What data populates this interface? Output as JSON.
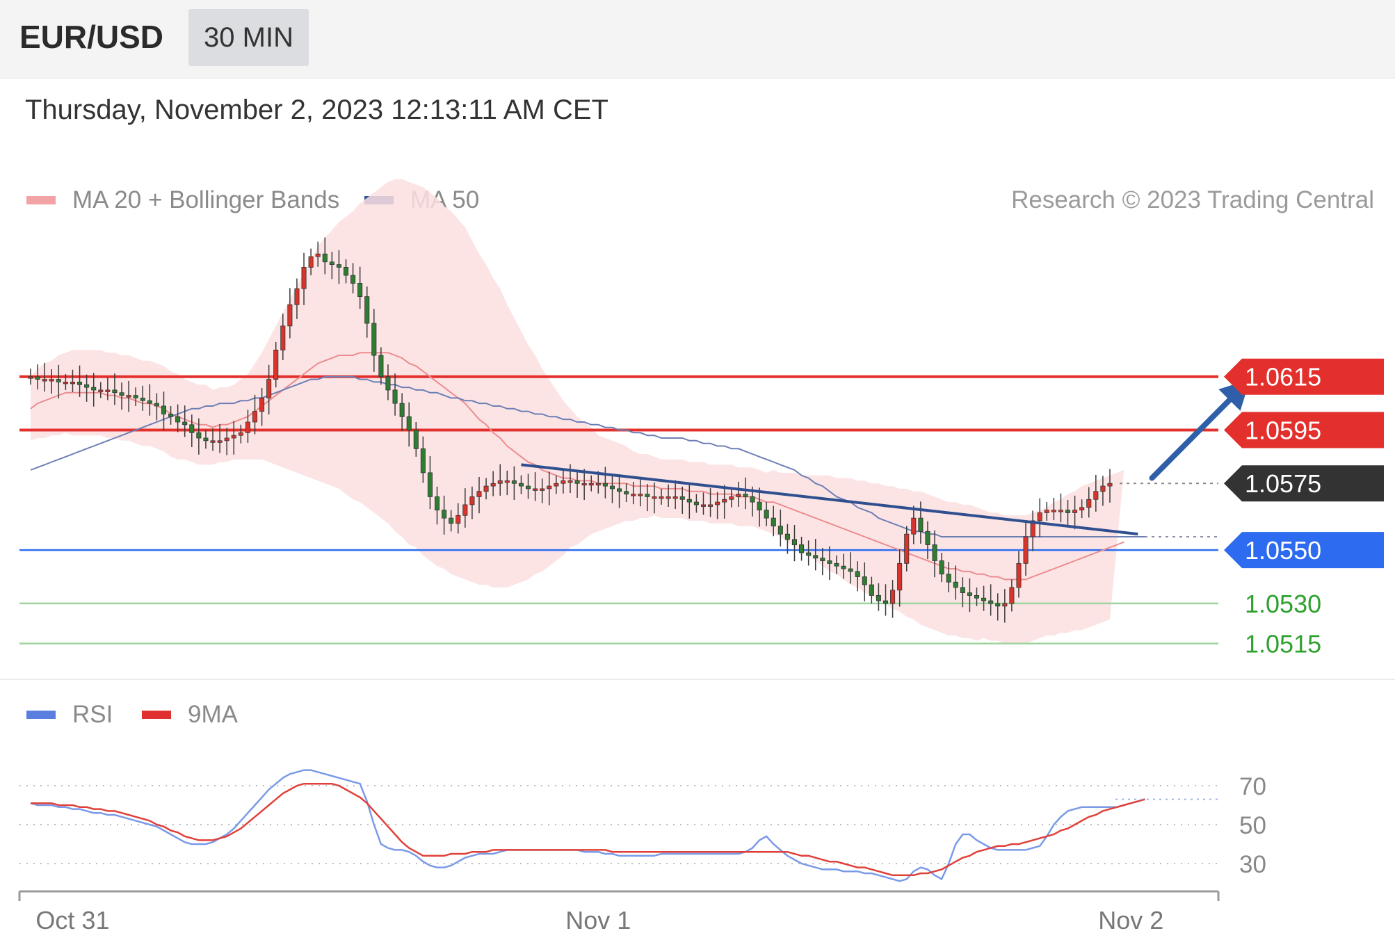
{
  "header": {
    "pair": "EUR/USD",
    "timeframe": "30 MIN"
  },
  "datetime": "Thursday, November 2, 2023 12:13:11 AM CET",
  "legend_main": [
    {
      "label": "MA 20 + Bollinger Bands",
      "color": "#e8868a"
    },
    {
      "label": "MA 50",
      "color": "#2f5597"
    }
  ],
  "legend_rsi": [
    {
      "label": "RSI",
      "color": "#5b7fe0"
    },
    {
      "label": "9MA",
      "color": "#e03030"
    }
  ],
  "copyright": "Research © 2023 Trading Central",
  "colors": {
    "resistance": "#e3302c",
    "current": "#333333",
    "pivot": "#2d6cf0",
    "support": "#2fa12f",
    "up_candle": "#d9342b",
    "down_candle": "#2e7d32",
    "arrow": "#2f5fa8",
    "trendline": "#2f4f8f"
  },
  "chart_data": [
    {
      "type": "candlestick",
      "title": "EUR/USD",
      "timeframe": "30 MIN",
      "x_tick_labels": [
        "Oct 31",
        "Nov 1",
        "Nov 2"
      ],
      "x_tick_index": [
        6,
        81,
        157
      ],
      "ylim": [
        1.0506,
        1.0678
      ],
      "levels": [
        {
          "label": "1.0615",
          "value": 1.0615,
          "kind": "resistance"
        },
        {
          "label": "1.0595",
          "value": 1.0595,
          "kind": "resistance"
        },
        {
          "label": "1.0575",
          "value": 1.0575,
          "kind": "current"
        },
        {
          "label": "1.0550",
          "value": 1.055,
          "kind": "pivot"
        },
        {
          "label": "1.0530",
          "value": 1.053,
          "kind": "support"
        },
        {
          "label": "1.0515",
          "value": 1.0515,
          "kind": "support"
        }
      ],
      "candles_close": [
        1.0615,
        1.0614,
        1.0614,
        1.0614,
        1.0613,
        1.0613,
        1.0613,
        1.0612,
        1.0611,
        1.061,
        1.061,
        1.061,
        1.0609,
        1.0608,
        1.0608,
        1.0607,
        1.0606,
        1.0605,
        1.0604,
        1.0601,
        1.06,
        1.0598,
        1.0597,
        1.0594,
        1.0592,
        1.0591,
        1.0591,
        1.0591,
        1.0592,
        1.0593,
        1.0594,
        1.0598,
        1.0602,
        1.0607,
        1.0614,
        1.0625,
        1.0634,
        1.0642,
        1.0648,
        1.0656,
        1.066,
        1.0661,
        1.0658,
        1.0657,
        1.0656,
        1.0653,
        1.065,
        1.0645,
        1.0635,
        1.0623,
        1.0615,
        1.061,
        1.0605,
        1.06,
        1.0595,
        1.0588,
        1.0579,
        1.057,
        1.0565,
        1.0562,
        1.056,
        1.0563,
        1.0567,
        1.057,
        1.0572,
        1.0574,
        1.0575,
        1.0576,
        1.0576,
        1.0575,
        1.0574,
        1.0573,
        1.0573,
        1.0573,
        1.0574,
        1.0575,
        1.0576,
        1.0576,
        1.0575,
        1.0575,
        1.0575,
        1.0575,
        1.0574,
        1.0573,
        1.0572,
        1.0571,
        1.0571,
        1.0571,
        1.057,
        1.057,
        1.057,
        1.057,
        1.057,
        1.0569,
        1.0568,
        1.0567,
        1.0567,
        1.0567,
        1.0568,
        1.0569,
        1.057,
        1.0571,
        1.057,
        1.0568,
        1.0565,
        1.0562,
        1.0559,
        1.0556,
        1.0554,
        1.0552,
        1.0549,
        1.0548,
        1.0547,
        1.0546,
        1.0545,
        1.0544,
        1.0543,
        1.0542,
        1.054,
        1.0537,
        1.0533,
        1.0531,
        1.053,
        1.0535,
        1.0545,
        1.0556,
        1.0562,
        1.0557,
        1.0552,
        1.0546,
        1.0541,
        1.0538,
        1.0536,
        1.0534,
        1.0533,
        1.0532,
        1.0531,
        1.053,
        1.0529,
        1.053,
        1.0536,
        1.0545,
        1.0555,
        1.0561,
        1.0564,
        1.0565,
        1.0565,
        1.0565,
        1.0564,
        1.0565,
        1.0566,
        1.0569,
        1.0572,
        1.0574,
        1.0575
      ],
      "ma20": [
        1.0603,
        1.0605,
        1.0606,
        1.0607,
        1.0608,
        1.0609,
        1.0609,
        1.0609,
        1.0609,
        1.0609,
        1.0609,
        1.0608,
        1.0608,
        1.0607,
        1.0607,
        1.0606,
        1.0605,
        1.0605,
        1.0604,
        1.0603,
        1.0601,
        1.06,
        1.0599,
        1.0598,
        1.0597,
        1.0597,
        1.0596,
        1.0597,
        1.0597,
        1.0598,
        1.0599,
        1.06,
        1.0602,
        1.0604,
        1.0606,
        1.0608,
        1.061,
        1.0612,
        1.0614,
        1.0616,
        1.0618,
        1.062,
        1.0621,
        1.0622,
        1.0623,
        1.0623,
        1.0623,
        1.0624,
        1.0624,
        1.0624,
        1.0624,
        1.0624,
        1.0623,
        1.0622,
        1.062,
        1.0619,
        1.0617,
        1.0615,
        1.0613,
        1.0611,
        1.0609,
        1.0607,
        1.0605,
        1.0602,
        1.0599,
        1.0597,
        1.0594,
        1.0592,
        1.0589,
        1.0587,
        1.0585,
        1.0583,
        1.0582,
        1.058,
        1.0579,
        1.0578,
        1.0577,
        1.0577,
        1.0576,
        1.0576,
        1.0576,
        1.0575,
        1.0575,
        1.0575,
        1.0575,
        1.0575,
        1.0574,
        1.0574,
        1.0574,
        1.0574,
        1.0573,
        1.0573,
        1.0573,
        1.0573,
        1.0572,
        1.0572,
        1.0572,
        1.0571,
        1.0571,
        1.0571,
        1.0571,
        1.057,
        1.057,
        1.057,
        1.0569,
        1.0568,
        1.0568,
        1.0567,
        1.0566,
        1.0565,
        1.0564,
        1.0563,
        1.0562,
        1.0561,
        1.056,
        1.0559,
        1.0558,
        1.0557,
        1.0556,
        1.0555,
        1.0554,
        1.0553,
        1.0552,
        1.0551,
        1.055,
        1.0549,
        1.0548,
        1.0547,
        1.0546,
        1.0545,
        1.0544,
        1.0543,
        1.0543,
        1.0542,
        1.0542,
        1.0541,
        1.0541,
        1.054,
        1.054,
        1.0539,
        1.0539,
        1.0539,
        1.0539,
        1.054,
        1.0541,
        1.0542,
        1.0543,
        1.0544,
        1.0545,
        1.0546,
        1.0547,
        1.0548,
        1.0549,
        1.055,
        1.0551,
        1.0552,
        1.0553
      ],
      "ma50": [
        1.058,
        1.0581,
        1.0582,
        1.0583,
        1.0584,
        1.0585,
        1.0586,
        1.0587,
        1.0588,
        1.0589,
        1.059,
        1.0591,
        1.0592,
        1.0593,
        1.0594,
        1.0595,
        1.0596,
        1.0597,
        1.0598,
        1.0599,
        1.06,
        1.0601,
        1.0602,
        1.0603,
        1.0603,
        1.0604,
        1.0604,
        1.0605,
        1.0605,
        1.0605,
        1.0606,
        1.0606,
        1.0607,
        1.0607,
        1.0608,
        1.0609,
        1.061,
        1.0611,
        1.0612,
        1.0613,
        1.0614,
        1.0614,
        1.0615,
        1.0615,
        1.0615,
        1.0615,
        1.0615,
        1.0614,
        1.0614,
        1.0613,
        1.0613,
        1.0612,
        1.0612,
        1.0611,
        1.0611,
        1.061,
        1.061,
        1.0609,
        1.0609,
        1.0608,
        1.0607,
        1.0607,
        1.0606,
        1.0606,
        1.0605,
        1.0605,
        1.0604,
        1.0604,
        1.0603,
        1.0603,
        1.0602,
        1.0602,
        1.0601,
        1.0601,
        1.06,
        1.06,
        1.0599,
        1.0599,
        1.0598,
        1.0598,
        1.0597,
        1.0597,
        1.0596,
        1.0596,
        1.0595,
        1.0595,
        1.0594,
        1.0594,
        1.0593,
        1.0593,
        1.0592,
        1.0592,
        1.0592,
        1.0592,
        1.0591,
        1.0591,
        1.059,
        1.059,
        1.0589,
        1.0589,
        1.0588,
        1.0588,
        1.0587,
        1.0586,
        1.0585,
        1.0584,
        1.0583,
        1.0582,
        1.0581,
        1.058,
        1.0578,
        1.0577,
        1.0575,
        1.0574,
        1.0572,
        1.057,
        1.0569,
        1.0568,
        1.0566,
        1.0565,
        1.0564,
        1.0562,
        1.0561,
        1.056,
        1.0559,
        1.0558,
        1.0557,
        1.0557,
        1.0556,
        1.0556,
        1.0555,
        1.0555,
        1.0555,
        1.0555,
        1.0555,
        1.0555,
        1.0555,
        1.0555,
        1.0555,
        1.0555,
        1.0555,
        1.0555,
        1.0555,
        1.0555,
        1.0555,
        1.0555,
        1.0555,
        1.0555,
        1.0555,
        1.0555,
        1.0555,
        1.0555,
        1.0555,
        1.0555,
        1.0555,
        1.0555,
        1.0555,
        1.0555,
        1.0555,
        1.0555
      ],
      "bb_width": [
        0.0012,
        0.0013,
        0.0014,
        0.0014,
        0.0015,
        0.0015,
        0.0016,
        0.0016,
        0.0016,
        0.0016,
        0.0016,
        0.0016,
        0.0016,
        0.0016,
        0.0016,
        0.0016,
        0.0016,
        0.0016,
        0.0016,
        0.0016,
        0.0016,
        0.0016,
        0.0015,
        0.0015,
        0.0015,
        0.0015,
        0.0014,
        0.0014,
        0.0014,
        0.0014,
        0.0015,
        0.0016,
        0.0018,
        0.002,
        0.0023,
        0.0026,
        0.0029,
        0.0032,
        0.0035,
        0.0038,
        0.0041,
        0.0044,
        0.0046,
        0.0048,
        0.005,
        0.0052,
        0.0054,
        0.0056,
        0.0058,
        0.006,
        0.0062,
        0.0064,
        0.0066,
        0.0067,
        0.0068,
        0.0068,
        0.0069,
        0.0069,
        0.0069,
        0.0068,
        0.0068,
        0.0067,
        0.0066,
        0.0064,
        0.0062,
        0.006,
        0.0058,
        0.0056,
        0.0053,
        0.005,
        0.0047,
        0.0044,
        0.0041,
        0.0038,
        0.0035,
        0.0032,
        0.0029,
        0.0026,
        0.0024,
        0.0022,
        0.002,
        0.0018,
        0.0017,
        0.0016,
        0.0015,
        0.0014,
        0.0013,
        0.0012,
        0.0012,
        0.0011,
        0.0011,
        0.0011,
        0.0011,
        0.0011,
        0.0011,
        0.0011,
        0.0011,
        0.0011,
        0.0011,
        0.0011,
        0.0011,
        0.0011,
        0.0011,
        0.0011,
        0.0011,
        0.0011,
        0.0012,
        0.0012,
        0.0013,
        0.0014,
        0.0014,
        0.0015,
        0.0016,
        0.0017,
        0.0018,
        0.0018,
        0.0019,
        0.002,
        0.002,
        0.0021,
        0.0021,
        0.0022,
        0.0022,
        0.0023,
        0.0023,
        0.0024,
        0.0024,
        0.0025,
        0.0025,
        0.0025,
        0.0025,
        0.0025,
        0.0025,
        0.0025,
        0.0025,
        0.0025,
        0.0024,
        0.0024,
        0.0024,
        0.0024,
        0.0024,
        0.0024,
        0.0024,
        0.0024,
        0.0024,
        0.0024,
        0.0025,
        0.0025,
        0.0026,
        0.0026,
        0.0027,
        0.0027,
        0.0027,
        0.0027,
        0.0027,
        0.0027,
        0.0027,
        0.0027,
        0.0027,
        0.0027,
        0.0027,
        0.0027
      ],
      "trendline": [
        {
          "index": 70,
          "value": 1.0582
        },
        {
          "index": 158,
          "value": 1.0556
        }
      ],
      "arrow": {
        "from": {
          "index": 160,
          "value": 1.0577
        },
        "to": {
          "index": 174,
          "value": 1.0614
        }
      }
    },
    {
      "type": "line",
      "title": "RSI",
      "ylim": [
        20,
        85
      ],
      "y_ticks": [
        70,
        50,
        30
      ],
      "series": [
        {
          "name": "RSI",
          "values": [
            61,
            60,
            60,
            60,
            59,
            59,
            58,
            58,
            57,
            56,
            56,
            55,
            55,
            54,
            53,
            52,
            51,
            50,
            49,
            47,
            45,
            43,
            41,
            40,
            40,
            40,
            41,
            43,
            45,
            48,
            52,
            56,
            60,
            64,
            68,
            71,
            74,
            76,
            77,
            78,
            78,
            77,
            76,
            75,
            74,
            73,
            72,
            71,
            62,
            50,
            40,
            38,
            37,
            37,
            36,
            34,
            31,
            29,
            28,
            28,
            29,
            31,
            33,
            34,
            35,
            35,
            35,
            36,
            37,
            37,
            37,
            37,
            37,
            37,
            37,
            37,
            37,
            37,
            37,
            36,
            36,
            36,
            35,
            35,
            34,
            34,
            34,
            34,
            34,
            34,
            35,
            35,
            35,
            35,
            35,
            35,
            35,
            35,
            35,
            35,
            35,
            35,
            36,
            38,
            42,
            44,
            40,
            37,
            34,
            32,
            30,
            29,
            28,
            27,
            27,
            27,
            26,
            26,
            26,
            25,
            25,
            24,
            23,
            22,
            21,
            22,
            26,
            28,
            27,
            24,
            22,
            30,
            40,
            45,
            45,
            42,
            40,
            38,
            37,
            37,
            37,
            37,
            37,
            38,
            39,
            44,
            50,
            54,
            57,
            58,
            59,
            59,
            59,
            59,
            59,
            59,
            60,
            61,
            62,
            63
          ]
        },
        {
          "name": "9MA",
          "values": [
            61,
            61,
            61,
            61,
            60,
            60,
            60,
            59,
            59,
            58,
            58,
            57,
            57,
            56,
            55,
            54,
            53,
            52,
            50,
            49,
            47,
            46,
            44,
            43,
            42,
            42,
            42,
            43,
            44,
            46,
            48,
            51,
            54,
            57,
            60,
            63,
            66,
            68,
            70,
            71,
            71,
            71,
            71,
            71,
            70,
            68,
            66,
            64,
            61,
            57,
            53,
            49,
            45,
            41,
            38,
            36,
            34,
            34,
            34,
            34,
            35,
            35,
            35,
            36,
            36,
            36,
            37,
            37,
            37,
            37,
            37,
            37,
            37,
            37,
            37,
            37,
            37,
            37,
            37,
            37,
            37,
            37,
            37,
            36,
            36,
            36,
            36,
            36,
            36,
            36,
            36,
            36,
            36,
            36,
            36,
            36,
            36,
            36,
            36,
            36,
            36,
            36,
            36,
            36,
            36,
            36,
            36,
            36,
            36,
            35,
            34,
            34,
            33,
            32,
            31,
            31,
            30,
            29,
            28,
            28,
            27,
            26,
            25,
            24,
            24,
            24,
            24,
            25,
            25,
            26,
            27,
            29,
            31,
            33,
            34,
            36,
            37,
            38,
            39,
            39,
            40,
            40,
            41,
            42,
            43,
            44,
            45,
            47,
            48,
            50,
            52,
            54,
            55,
            57,
            58,
            59,
            60,
            61,
            62,
            63
          ]
        }
      ]
    }
  ]
}
